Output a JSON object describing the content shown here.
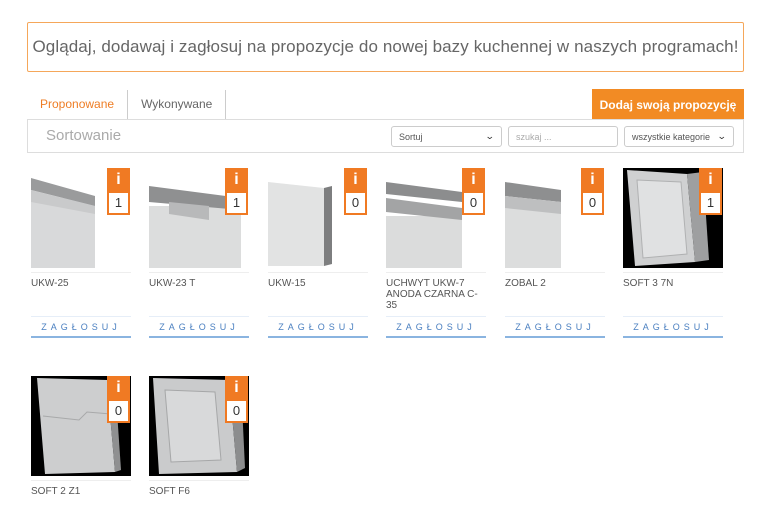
{
  "banner": {
    "text": "Oglądaj, dodawaj i zagłosuj na propozycje do nowej bazy kuchennej w naszych programach!"
  },
  "tabs": [
    {
      "label": "Proponowane",
      "active": true
    },
    {
      "label": "Wykonywane",
      "active": false
    }
  ],
  "add_button": {
    "label": "Dodaj swoją propozycję"
  },
  "toolbar": {
    "title": "Sortowanie",
    "sort_select": {
      "value": "Sortuj"
    },
    "search": {
      "placeholder": "szukaj ..."
    },
    "category_select": {
      "value": "wszystkie kategorie"
    }
  },
  "info_icon": "i",
  "vote_label": "ZAGŁOSUJ",
  "products": [
    {
      "name": "UKW-25",
      "votes": "1",
      "image": "steel-profile"
    },
    {
      "name": "UKW-23 T",
      "votes": "1",
      "image": "steel-handle-long"
    },
    {
      "name": "UKW-15",
      "votes": "0",
      "image": "steel-edge"
    },
    {
      "name": "UCHWYT UKW-7 ANODA CZARNA C-35",
      "votes": "0",
      "image": "steel-channel"
    },
    {
      "name": "ZOBAL 2",
      "votes": "0",
      "image": "steel-small"
    },
    {
      "name": "SOFT 3 7N",
      "votes": "1",
      "image": "door-panel-dark"
    },
    {
      "name": "SOFT 2 Z1",
      "votes": "0",
      "image": "door-panel-dark-2"
    },
    {
      "name": "SOFT F6",
      "votes": "0",
      "image": "door-panel-frame"
    }
  ]
}
